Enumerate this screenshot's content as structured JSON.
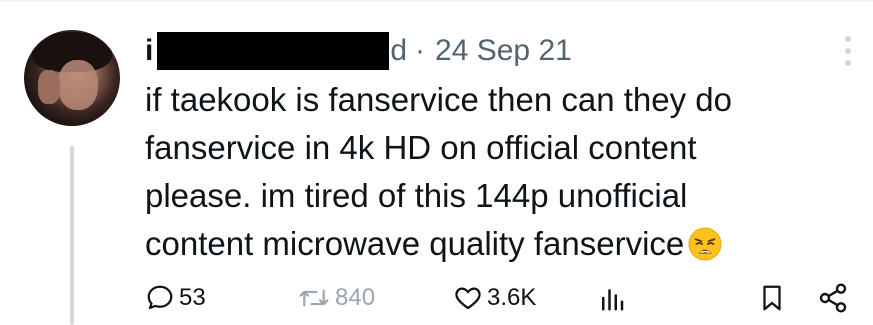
{
  "post": {
    "author_name_visible_start": "i",
    "handle_visible_end": "d",
    "separator": "·",
    "date": "24 Sep 21",
    "text": "if taekook is fanservice then can they do\nfanservice in 4k HD on official content\nplease. im tired of this 144p unofficial\ncontent microwave quality fanservice"
  },
  "actions": {
    "replies": "53",
    "retweets": "840",
    "likes": "3.6K"
  },
  "icons": [
    "more-icon",
    "reply-icon",
    "retweet-icon",
    "like-icon",
    "views-icon",
    "bookmark-icon",
    "share-icon",
    "weary-face-emoji"
  ],
  "colors": {
    "text": "#0f1419",
    "secondary": "#536471",
    "thread_line": "#cfd9de",
    "redaction": "#000000"
  }
}
